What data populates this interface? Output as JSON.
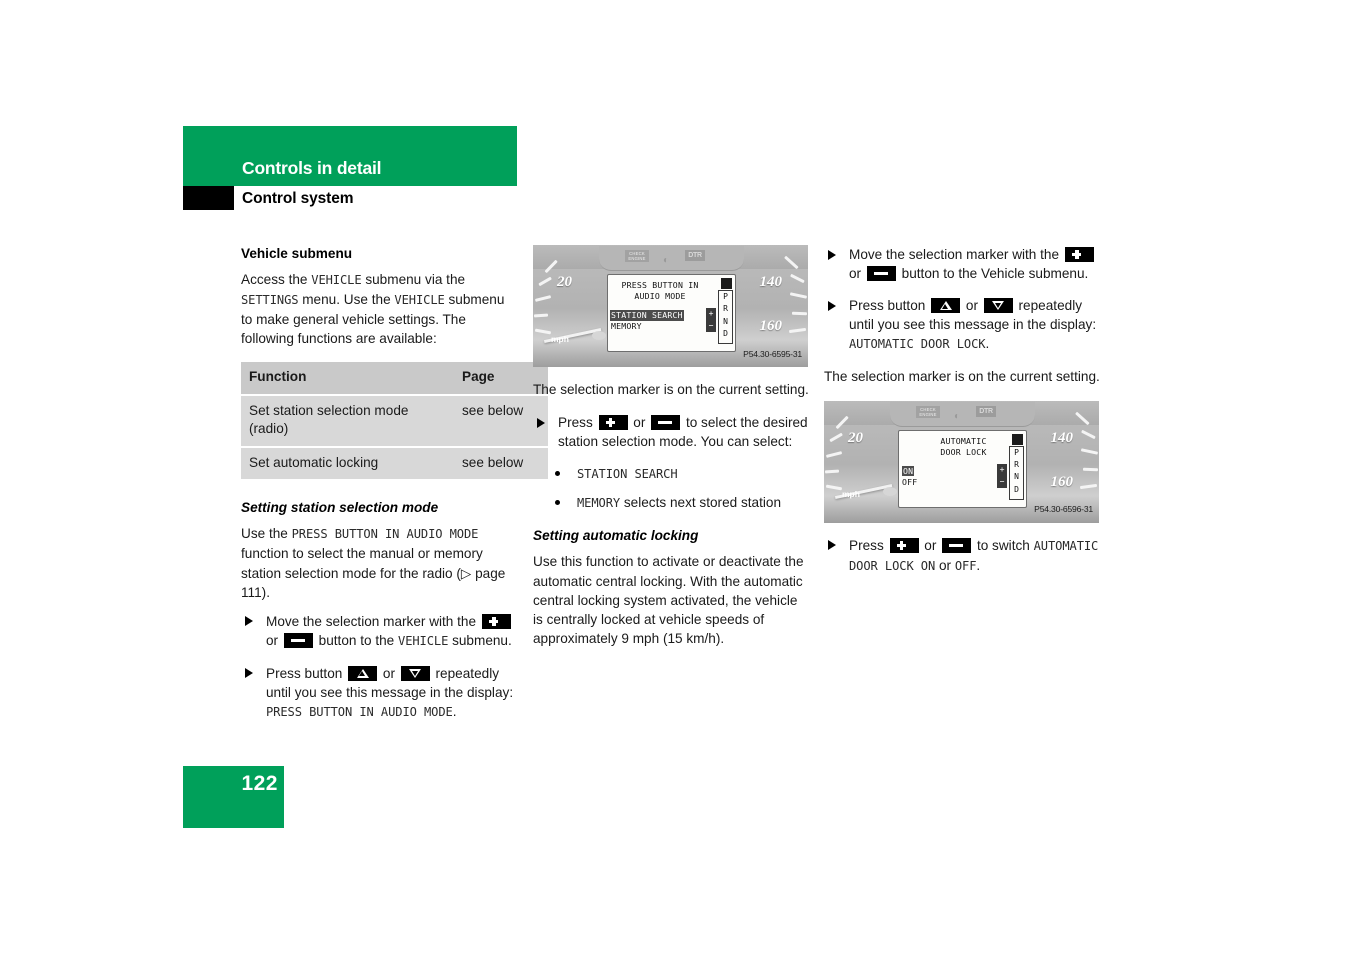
{
  "header": {
    "chapter": "Controls in detail",
    "section": "Control system"
  },
  "page_number": "122",
  "left_column": {
    "heading": "Vehicle submenu",
    "intro_1": "Access the ",
    "intro_mono_1": "VEHICLE",
    "intro_2": " submenu via the ",
    "intro_mono_2": "SETTINGS",
    "intro_3": " menu. Use the ",
    "intro_mono_3": "VEHICLE",
    "intro_4": " submenu to make general vehicle settings. The following functions are available:",
    "table": {
      "headers": [
        "Function",
        "Page"
      ],
      "rows": [
        [
          "Set station selection mode (radio)",
          "see below"
        ],
        [
          "Set automatic locking",
          "see below"
        ]
      ]
    },
    "subheading": "Setting station selection mode",
    "para_1": "Use the ",
    "para_mono_1": "PRESS BUTTON IN AUDIO MODE",
    "para_2": " function to select the manual or memory station selection mode for the radio (",
    "para_page_ref": "page 111",
    "para_3": ").",
    "steps": [
      {
        "text_1": "Move the selection marker with the ",
        "key_1": "plus-button",
        "text_2": " or ",
        "key_2": "minus-button",
        "text_3": " button to the ",
        "mono": "VEHICLE",
        "text_4": " submenu."
      },
      {
        "text_1": "Press button ",
        "key_1": "up-button",
        "text_2": " or ",
        "key_2": "down-button",
        "text_3": " repeatedly until you see this message in the display: ",
        "mono": "PRESS BUTTON IN AUDIO MODE",
        "text_4": "."
      }
    ]
  },
  "middle_column": {
    "figure": {
      "caption": "P54.30-6595-31",
      "speed_left": "20",
      "speed_right_top": "140",
      "speed_right_bottom": "160",
      "unit_label": "mph",
      "check_engine_label": "CHECK ENGINE",
      "dtr_label": "DTR",
      "lcd": {
        "title_line_1": "PRESS BUTTON IN",
        "title_line_2": "AUDIO MODE",
        "option_selected": "STATION SEARCH",
        "option_other": "MEMORY",
        "gear_indicator": "PRND",
        "plus_label": "+",
        "minus_label": "−"
      }
    },
    "para_after_figure": "The selection marker is on the current setting.",
    "step": {
      "text_1": "Press ",
      "key_1": "plus-button",
      "text_2": " or ",
      "key_2": "minus-button",
      "text_3": " to select the desired station selection mode. You can select:"
    },
    "options": [
      {
        "mono": "STATION SEARCH",
        "text": ""
      },
      {
        "mono": "MEMORY",
        "text": " selects next stored station"
      }
    ],
    "subheading": "Setting automatic locking",
    "para": "Use this function to activate or deactivate the automatic central locking. With the automatic central locking system activated, the vehicle is centrally locked at vehicle speeds of approximately 9 mph (15 km/h)."
  },
  "right_column": {
    "steps": [
      {
        "text_1": "Move the selection marker with the ",
        "key_1": "plus-button",
        "text_2": " or ",
        "key_2": "minus-button",
        "text_3": " button to the Vehicle submenu."
      },
      {
        "text_1": "Press button ",
        "key_1": "up-button",
        "text_2": " or ",
        "key_2": "down-button",
        "text_3": " repeatedly until you see this message in the display: ",
        "mono": "AUTOMATIC DOOR LOCK",
        "text_4": "."
      }
    ],
    "para_after_steps": "The selection marker is on the current setting.",
    "figure": {
      "caption": "P54.30-6596-31",
      "speed_left": "20",
      "speed_right_top": "140",
      "speed_right_bottom": "160",
      "unit_label": "mph",
      "check_engine_label": "CHECK ENGINE",
      "dtr_label": "DTR",
      "lcd": {
        "title_line_1": "AUTOMATIC",
        "title_line_2": "DOOR LOCK",
        "option_selected": "ON",
        "option_other": "OFF",
        "gear_indicator": "PRND",
        "plus_label": "+",
        "minus_label": "−"
      }
    },
    "final_step": {
      "text_1": "Press ",
      "key_1": "plus-button",
      "text_2": " or ",
      "key_2": "minus-button",
      "text_3": " to switch ",
      "mono_1": "AUTOMATIC DOOR LOCK ON",
      "text_4": " or ",
      "mono_2": "OFF",
      "text_5": "."
    }
  },
  "colors": {
    "brand_green": "#00a05a",
    "table_header_bg": "#c9c9c9",
    "table_cell_bg": "#d8d8d8",
    "text": "#000000"
  }
}
